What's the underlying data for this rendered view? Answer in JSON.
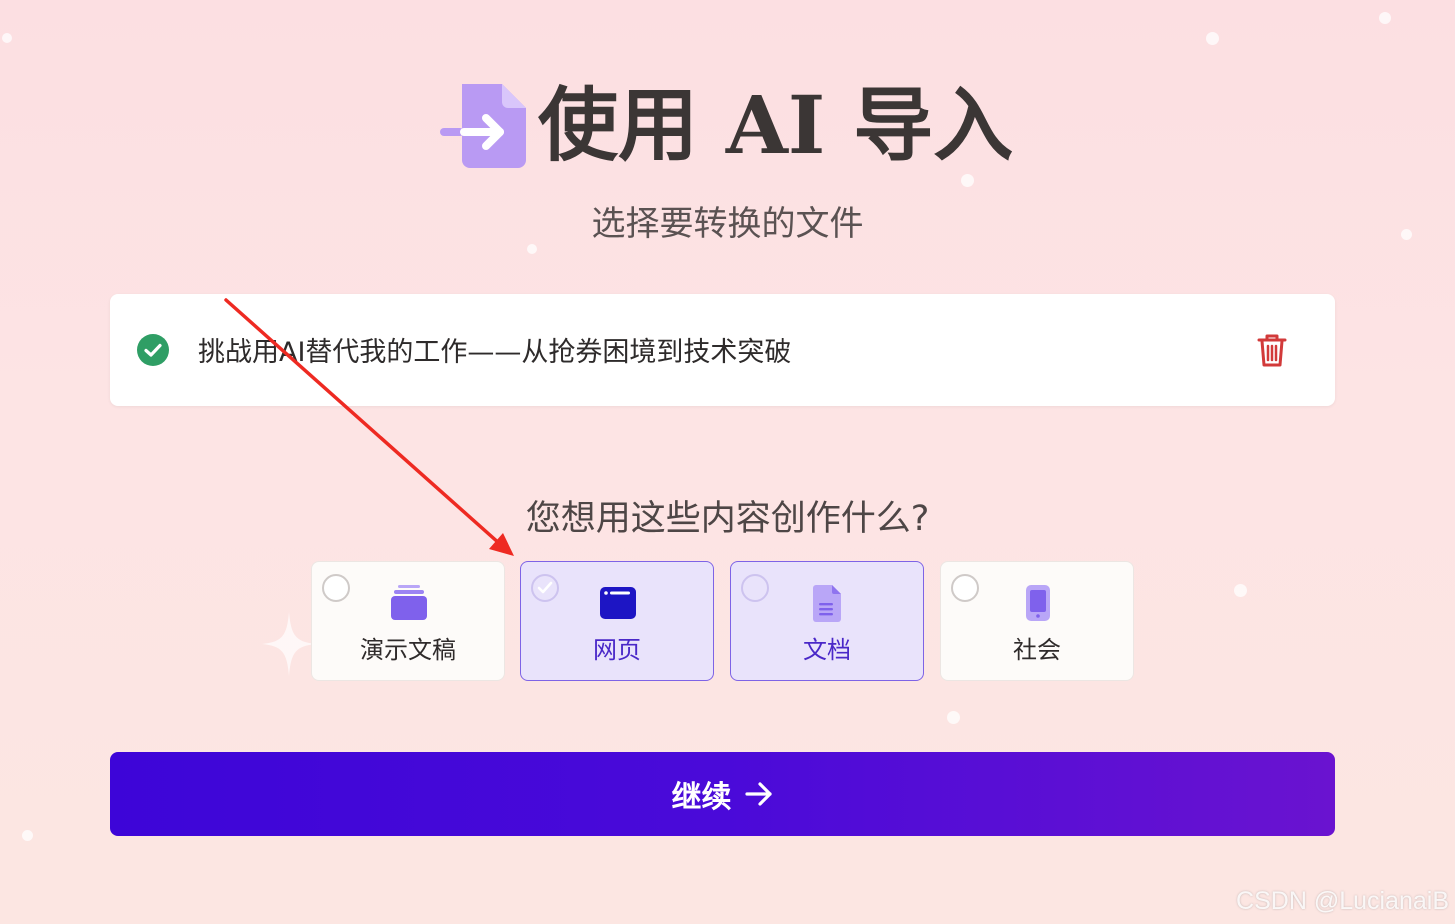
{
  "header": {
    "title": "使用 AI 导入",
    "subtitle": "选择要转换的文件"
  },
  "file": {
    "name": "挑战用AI替代我的工作——从抢券困境到技术突破",
    "status_icon": "check-circle-icon",
    "delete_icon": "trash-icon"
  },
  "question": "您想用这些内容创作什么?",
  "options": [
    {
      "label": "演示文稿",
      "icon": "presentation-icon",
      "selected": false,
      "checked": false
    },
    {
      "label": "网页",
      "icon": "webpage-icon",
      "selected": true,
      "checked": true
    },
    {
      "label": "文档",
      "icon": "document-icon",
      "selected": true,
      "checked": false
    },
    {
      "label": "社会",
      "icon": "phone-icon",
      "selected": false,
      "checked": false
    }
  ],
  "continue_button": {
    "label": "继续",
    "icon": "arrow-right-icon"
  },
  "watermark": "CSDN @LucianaiB",
  "colors": {
    "accent": "#7d5ce3",
    "button_start": "#3d05d8",
    "button_end": "#6a13d0",
    "success": "#2f9e65",
    "danger": "#d23a3a",
    "annotation": "#ee2a22"
  }
}
